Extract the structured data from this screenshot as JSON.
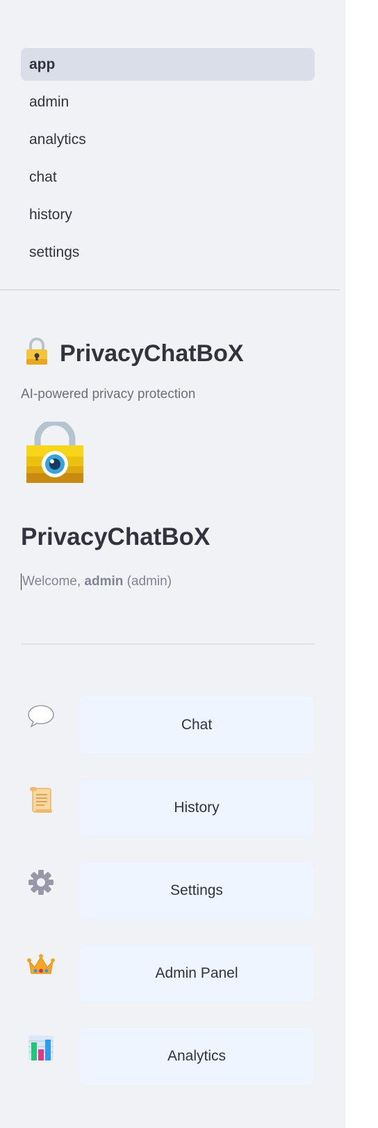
{
  "nav": {
    "items": [
      {
        "label": "app",
        "active": true
      },
      {
        "label": "admin",
        "active": false
      },
      {
        "label": "analytics",
        "active": false
      },
      {
        "label": "chat",
        "active": false
      },
      {
        "label": "history",
        "active": false
      },
      {
        "label": "settings",
        "active": false
      }
    ]
  },
  "brand": {
    "icon": "lock-icon",
    "title": "PrivacyChatBoX",
    "tagline": "AI-powered privacy protection",
    "logo": "lock-eye-icon"
  },
  "main": {
    "title": "PrivacyChatBoX",
    "welcome_prefix": "Welcome, ",
    "username": "admin",
    "role": "(admin)"
  },
  "menu": [
    {
      "icon": "speech-bubble-icon",
      "label": "Chat"
    },
    {
      "icon": "scroll-icon",
      "label": "History"
    },
    {
      "icon": "gear-icon",
      "label": "Settings"
    },
    {
      "icon": "crown-icon",
      "label": "Admin Panel"
    },
    {
      "icon": "bar-chart-icon",
      "label": "Analytics"
    }
  ],
  "colors": {
    "sidebar_bg": "#f0f2f6",
    "active_nav_bg": "#dadee9",
    "button_bg": "#eef5fe",
    "text": "#31333f",
    "muted_text": "#808495"
  }
}
